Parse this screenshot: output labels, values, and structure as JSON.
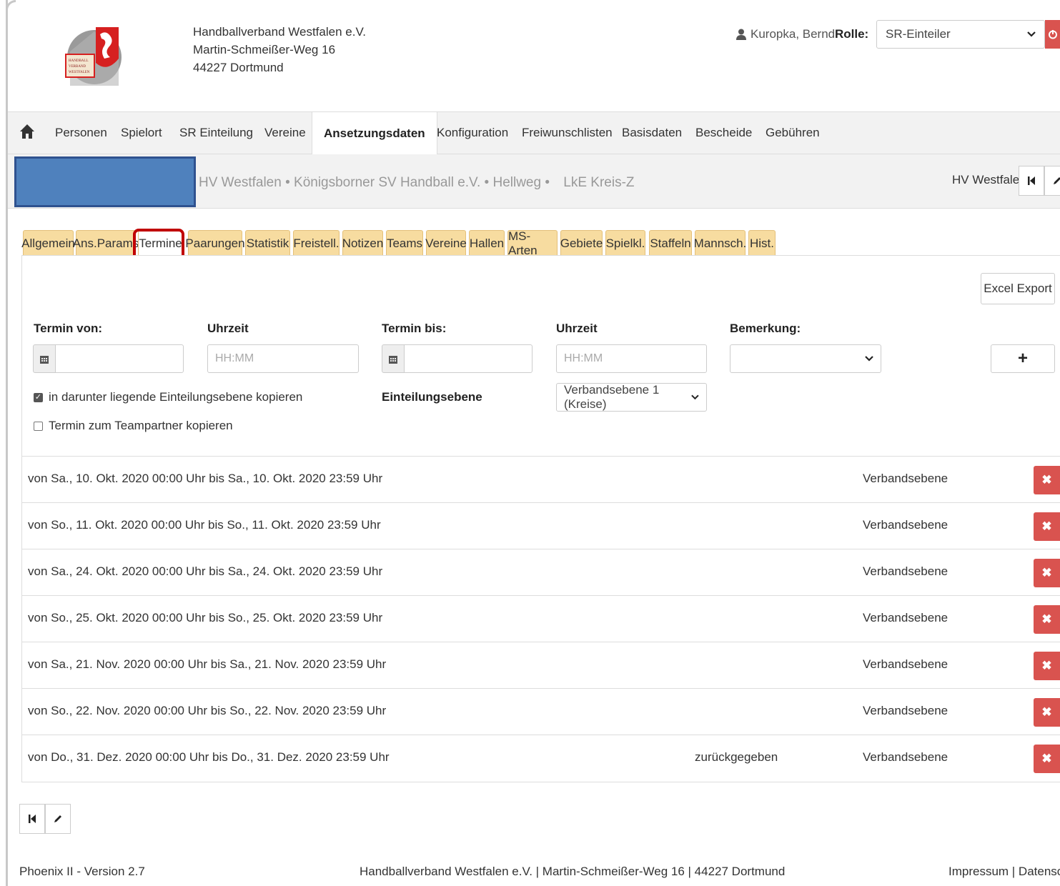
{
  "header": {
    "org_line1": "Handballverband Westfalen e.V.",
    "org_line2": "Martin-Schmeißer-Weg 16",
    "org_line3": "44227 Dortmund",
    "user_name": "Kuropka, Bernd",
    "role_label": "Rolle:",
    "role_value": "SR-Einteiler",
    "logo_text": [
      "HANDBALL",
      "VERBAND",
      "WESTFALEN"
    ]
  },
  "nav": {
    "items": [
      "Personen",
      "Spielort",
      "SR Einteilung",
      "Vereine",
      "Ansetzungsdaten",
      "Konfiguration",
      "Freiwunschlisten",
      "Basisdaten",
      "Bescheide",
      "Gebühren"
    ],
    "active": "Ansetzungsdaten"
  },
  "breadcrumb": {
    "path": "HV Westfalen • Königsborner SV Handball e.V. • Hellweg •",
    "extra": "LkE Kreis-Z",
    "right_label": "HV Westfalen"
  },
  "tabs": {
    "items": [
      "Allgemein",
      "Ans.Params",
      "Termine",
      "Paarungen",
      "Statistik",
      "Freistell.",
      "Notizen",
      "Teams",
      "Vereine",
      "Hallen",
      "MS-Arten",
      "Gebiete",
      "Spielkl.",
      "Staffeln",
      "Mannsch.",
      "Hist."
    ],
    "active": "Termine"
  },
  "form": {
    "excel_export": "Excel Export",
    "termin_von": "Termin von:",
    "uhrzeit1": "Uhrzeit",
    "termin_bis": "Termin bis:",
    "uhrzeit2": "Uhrzeit",
    "bemerkung": "Bemerkung:",
    "time_placeholder": "HH:MM",
    "add_label": "+",
    "copy_lower_label": "in darunter liegende Einteilungsebene kopieren",
    "copy_lower_checked": true,
    "einteilungsebene_label": "Einteilungsebene",
    "einteilungsebene_value": "Verbandsebene 1 (Kreise)",
    "copy_partner_label": "Termin zum Teampartner kopieren",
    "copy_partner_checked": false
  },
  "rows": [
    {
      "text": "von Sa., 10. Okt. 2020 00:00 Uhr bis Sa., 10. Okt. 2020 23:59 Uhr",
      "note": "",
      "level": "Verbandsebene"
    },
    {
      "text": "von So., 11. Okt. 2020 00:00 Uhr bis So., 11. Okt. 2020 23:59 Uhr",
      "note": "",
      "level": "Verbandsebene"
    },
    {
      "text": "von Sa., 24. Okt. 2020 00:00 Uhr bis Sa., 24. Okt. 2020 23:59 Uhr",
      "note": "",
      "level": "Verbandsebene"
    },
    {
      "text": "von So., 25. Okt. 2020 00:00 Uhr bis So., 25. Okt. 2020 23:59 Uhr",
      "note": "",
      "level": "Verbandsebene"
    },
    {
      "text": "von Sa., 21. Nov. 2020 00:00 Uhr bis Sa., 21. Nov. 2020 23:59 Uhr",
      "note": "",
      "level": "Verbandsebene"
    },
    {
      "text": "von So., 22. Nov. 2020 00:00 Uhr bis So., 22. Nov. 2020 23:59 Uhr",
      "note": "",
      "level": "Verbandsebene"
    },
    {
      "text": "von Do., 31. Dez. 2020 00:00 Uhr bis Do., 31. Dez. 2020 23:59 Uhr",
      "note": "zurückgegeben",
      "level": "Verbandsebene"
    }
  ],
  "footer": {
    "version": "Phoenix II - Version 2.7",
    "address": "Handballverband Westfalen e.V. | Martin-Schmeißer-Weg 16 | 44227 Dortmund",
    "links": "Impressum | Datenschu"
  },
  "colors": {
    "tab_bg": "#f7dca0",
    "delete_red": "#d9534f",
    "highlight_red": "#c00000",
    "redaction_blue": "#4f81bd",
    "nav_bg": "#f2f2f2"
  },
  "icons": {
    "home": "home-icon",
    "user": "user-icon",
    "logout": "power-icon",
    "calendar": "calendar-icon",
    "first_page": "first-page-icon",
    "edit": "pencil-icon",
    "delete": "times-icon",
    "chevron": "chevron-down-icon"
  }
}
